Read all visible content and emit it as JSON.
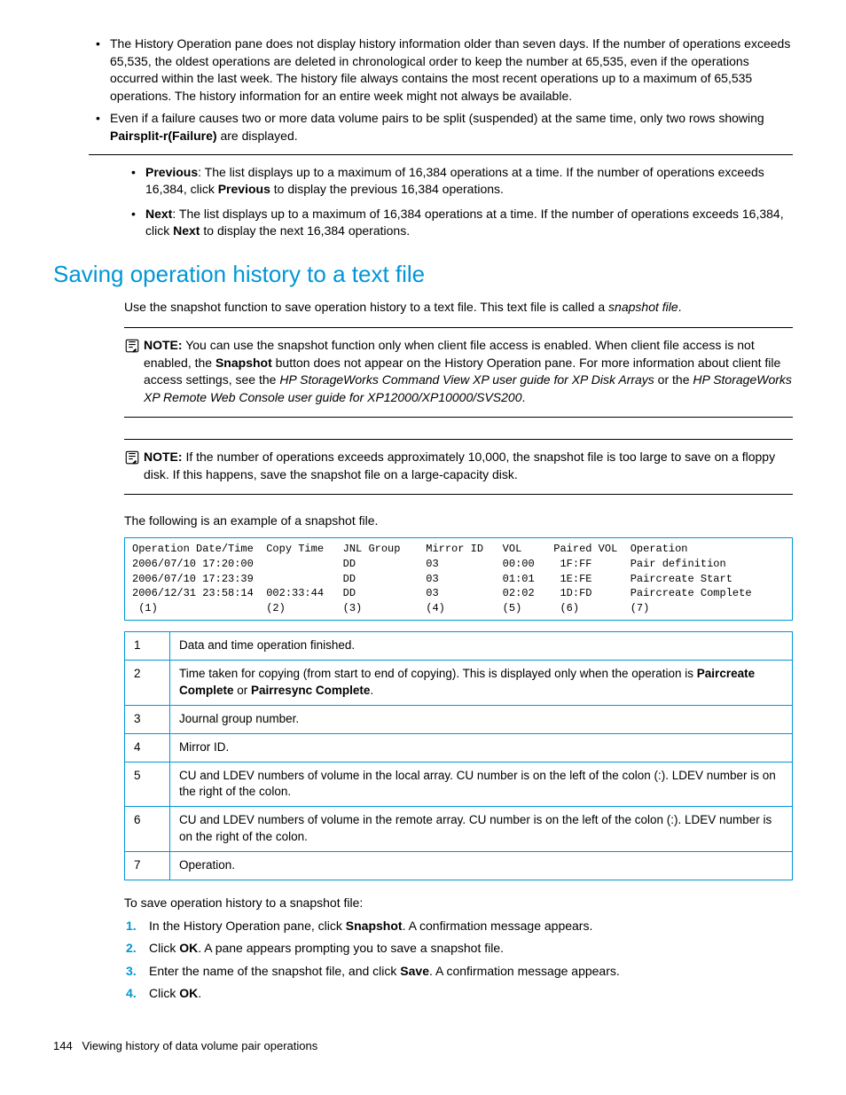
{
  "top_bullets": [
    {
      "text": "The History Operation pane does not display history information older than seven days. If the number of operations exceeds 65,535, the oldest operations are deleted in chronological order to keep the number at 65,535, even if the operations occurred within the last week. The history file always contains the most recent operations up to a maximum of 65,535 operations. The history information for an entire week might not always be available."
    },
    {
      "prefix": "Even if a failure causes two or more data volume pairs to be split (suspended) at the same time, only two rows showing ",
      "bold": "Pairsplit-r(Failure)",
      "suffix": " are displayed."
    }
  ],
  "prev_next": {
    "previous": {
      "label": "Previous",
      "text_a": ":  The list displays up to a maximum of 16,384 operations at a time. If the number of operations exceeds 16,384, click ",
      "bold": "Previous",
      "text_b": " to display the previous 16,384 operations."
    },
    "next": {
      "label": "Next",
      "text_a": ": The list displays up to a maximum of 16,384 operations at a time. If the number of operations exceeds 16,384, click ",
      "bold": "Next",
      "text_b": " to display the next 16,384 operations."
    }
  },
  "section_title": "Saving operation history to a text file",
  "intro": {
    "text_a": "Use the snapshot function to save operation history to a text file. This text file is called a ",
    "italic": "snapshot file",
    "text_b": "."
  },
  "note1": {
    "label": "NOTE:",
    "text_a": "You can use the snapshot function only when client file access is enabled. When client file access is not enabled, the ",
    "bold1": "Snapshot",
    "text_b": " button does not appear on the History Operation pane. For more information about client file access settings, see the ",
    "italic1": "HP StorageWorks Command View XP user guide for XP Disk Arrays",
    "text_c": " or the ",
    "italic2": "HP StorageWorks XP Remote Web Console user guide for XP12000/XP10000/SVS200",
    "text_d": "."
  },
  "note2": {
    "label": "NOTE:",
    "text": "If the number of operations exceeds approximately 10,000, the snapshot file is too large to save on a floppy disk. If this happens, save the snapshot file on a large-capacity disk."
  },
  "example_lead": "The following is an example of a snapshot file.",
  "code": "Operation Date/Time  Copy Time   JNL Group    Mirror ID   VOL     Paired VOL  Operation\n2006/07/10 17:20:00              DD           03          00:00    1F:FF      Pair definition\n2006/07/10 17:23:39              DD           03          01:01    1E:FE      Paircreate Start\n2006/12/31 23:58:14  002:33:44   DD           03          02:02    1D:FD      Paircreate Complete\n (1)                 (2)         (3)          (4)         (5)      (6)        (7)",
  "legend": [
    {
      "num": "1",
      "text": "Data and time operation finished."
    },
    {
      "num": "2",
      "prefix": "Time taken for copying (from start to end of copying). This is displayed only when the operation is ",
      "bold1": "Paircreate Complete",
      "mid": " or ",
      "bold2": "Pairresync Complete",
      "suffix": "."
    },
    {
      "num": "3",
      "text": "Journal group number."
    },
    {
      "num": "4",
      "text": "Mirror ID."
    },
    {
      "num": "5",
      "text": "CU and LDEV numbers of volume in the local array. CU number is on the left of the colon (:). LDEV number is on the right of the colon."
    },
    {
      "num": "6",
      "text": "CU and LDEV numbers of volume in the remote array. CU number is on the left of the colon (:). LDEV number is on the right of the colon."
    },
    {
      "num": "7",
      "text": "Operation."
    }
  ],
  "steps_lead": "To save operation history to a snapshot file:",
  "steps": [
    {
      "num": "1.",
      "prefix": "In the History Operation pane, click ",
      "bold": "Snapshot",
      "suffix": ". A confirmation message appears."
    },
    {
      "num": "2.",
      "prefix": "Click ",
      "bold": "OK",
      "suffix": ". A pane appears prompting you to save a snapshot file."
    },
    {
      "num": "3.",
      "prefix": "Enter the name of the snapshot file, and click ",
      "bold": "Save",
      "suffix": ". A confirmation message appears."
    },
    {
      "num": "4.",
      "prefix": "Click ",
      "bold": "OK",
      "suffix": "."
    }
  ],
  "footer": {
    "page": "144",
    "title": "Viewing history of data volume pair operations"
  }
}
